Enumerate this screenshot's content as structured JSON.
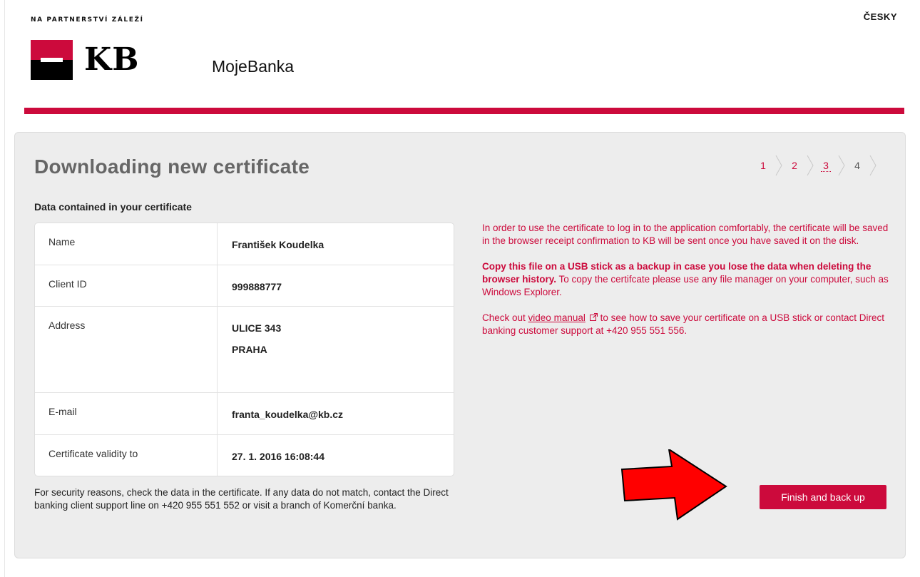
{
  "header": {
    "tagline": "NA PARTNERSTVÍ ZÁLEŽÍ",
    "language_link": "ČESKY",
    "logo_text": "KB",
    "app_name": "MojeBanka",
    "brand_color": "#cc0a3c"
  },
  "wizard": {
    "title": "Downloading new certificate",
    "steps": [
      {
        "label": "1",
        "state": "done"
      },
      {
        "label": "2",
        "state": "done"
      },
      {
        "label": "3",
        "state": "current"
      },
      {
        "label": "4",
        "state": "future"
      }
    ]
  },
  "certificate": {
    "section_label": "Data contained in your certificate",
    "rows": [
      {
        "label": "Name",
        "value": "František Koudelka"
      },
      {
        "label": "Client ID",
        "value": "999888777"
      },
      {
        "label": "Address",
        "value_line1": "ULICE 343",
        "value_line2": "PRAHA"
      },
      {
        "label": "E-mail",
        "value": "franta_koudelka@kb.cz"
      },
      {
        "label": "Certificate validity to",
        "value": "27. 1. 2016 16:08:44"
      }
    ],
    "security_note": "For security reasons, check the data in the certificate. If any data do not match, contact the Direct banking client support line on +420 955 551 552 or visit a branch of Komerční banka."
  },
  "info": {
    "paragraph1": "In order to use the certificate to log in to the application comfortably, the certificate will be saved in the browser receipt confirmation to KB will be sent once you have saved it on the disk.",
    "paragraph2_bold": "Copy this file on a USB stick as a backup in case you lose the data when deleting the browser history.",
    "paragraph2_rest": " To copy the certifcate please use any file manager on your computer, such as Windows Explorer.",
    "paragraph3_pre": "Check out ",
    "paragraph3_link": "video manual",
    "paragraph3_post": " to see how to save your certificate on a USB stick or contact Direct banking customer support at +420 955 551 556.",
    "external_icon": "external-link-icon"
  },
  "actions": {
    "finish_label": "Finish and back up",
    "arrow_icon": "red-arrow-icon",
    "arrow_color": "#ff0000"
  }
}
